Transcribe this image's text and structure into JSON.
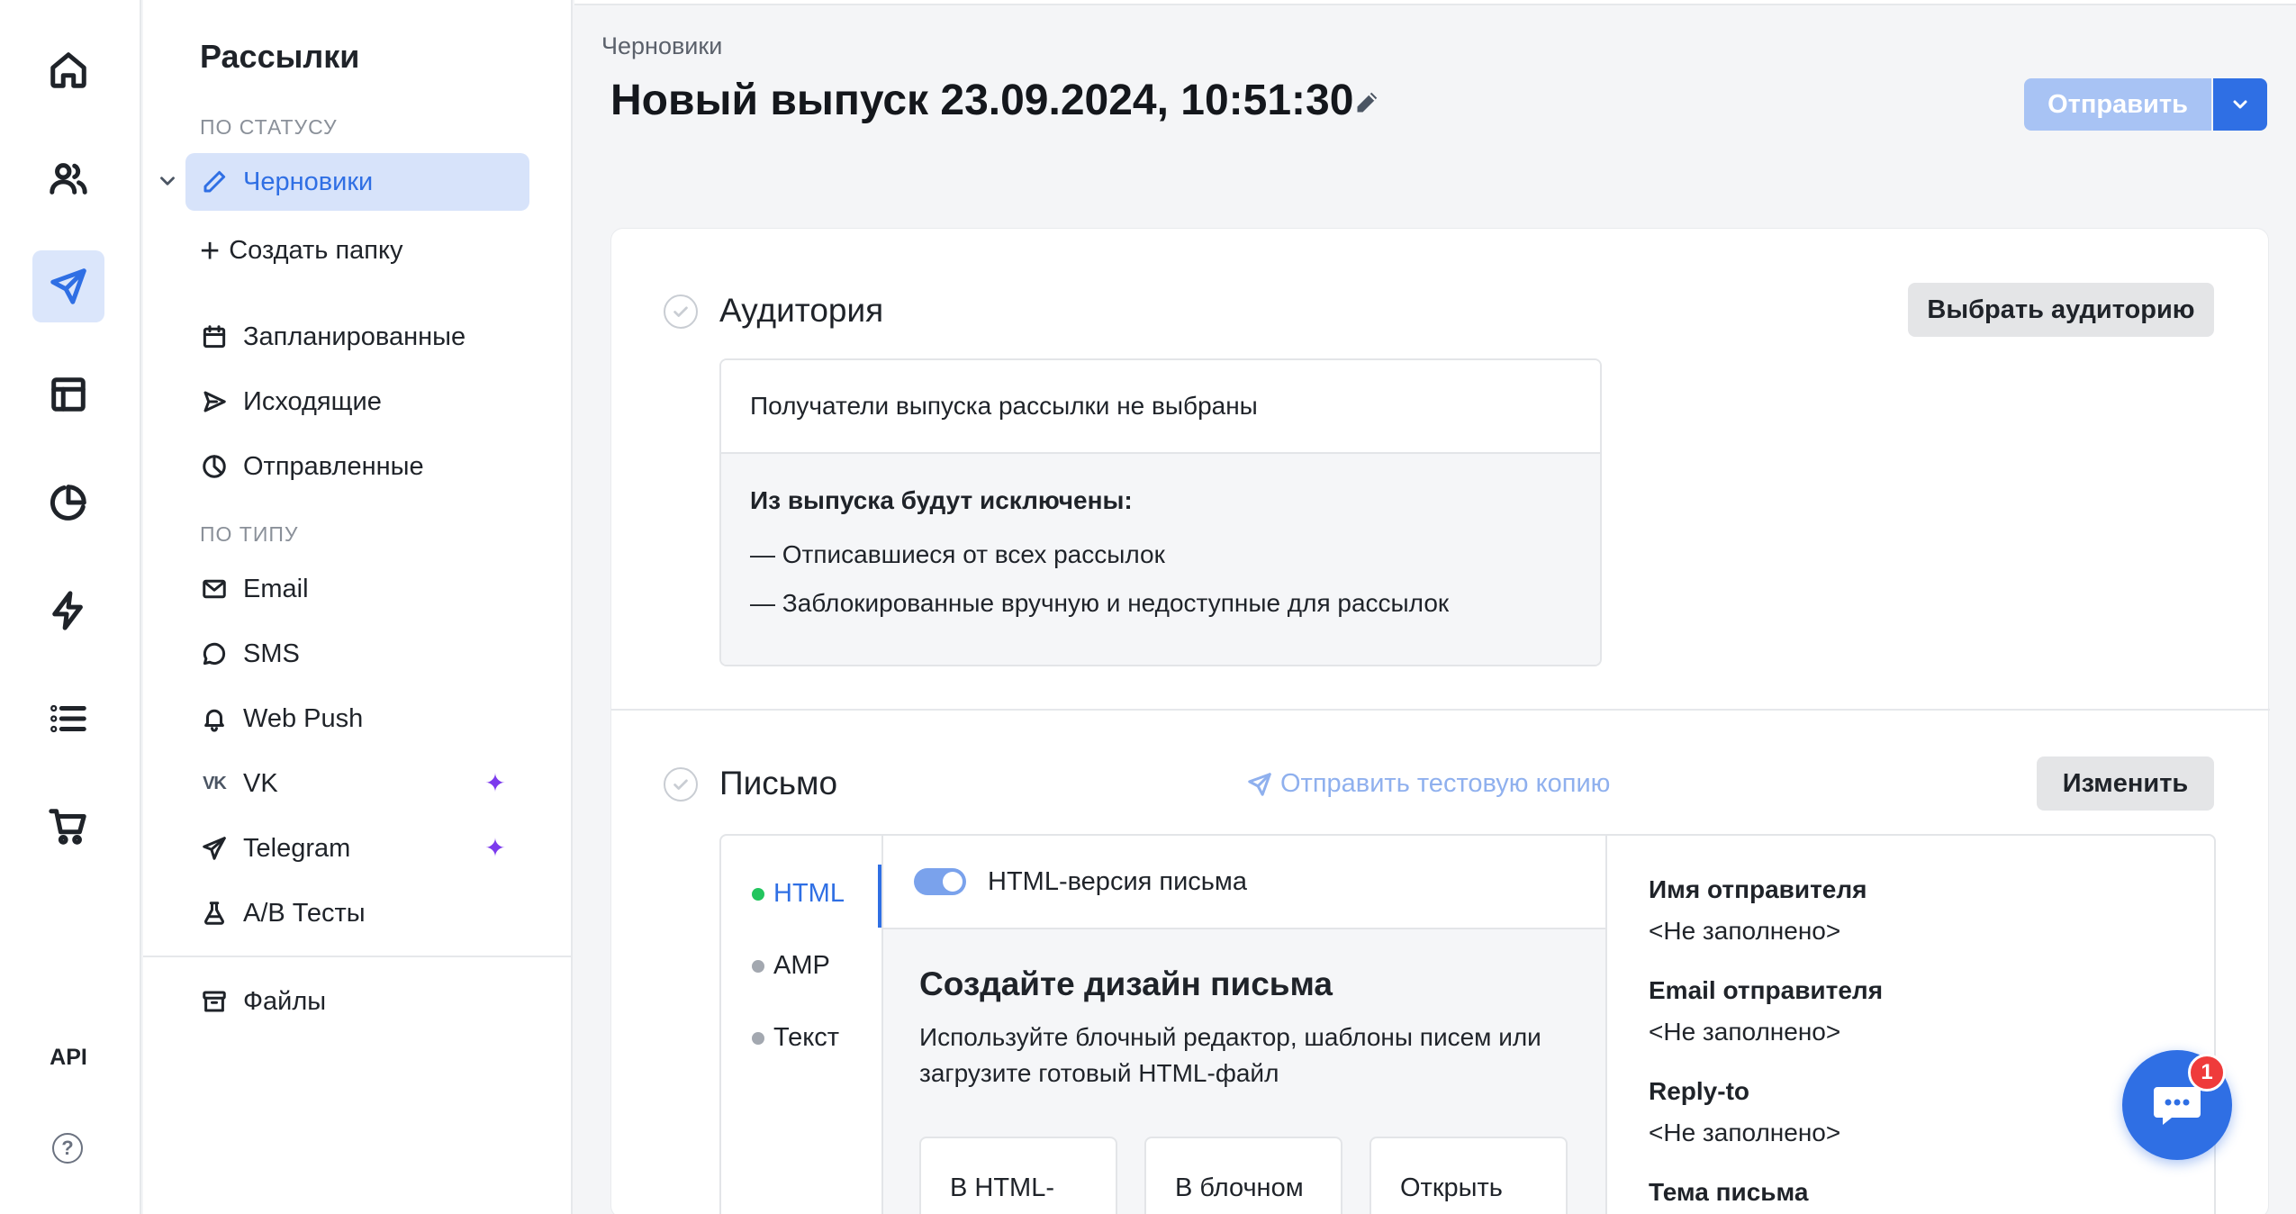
{
  "rail": {
    "api_label": "API",
    "help_label": "?"
  },
  "sidebar": {
    "title": "Рассылки",
    "section_status": "ПО СТАТУСУ",
    "drafts": "Черновики",
    "create_folder": "Создать папку",
    "scheduled": "Запланированные",
    "outgoing": "Исходящие",
    "sent": "Отправленные",
    "section_type": "ПО ТИПУ",
    "email": "Email",
    "sms": "SMS",
    "webpush": "Web Push",
    "vk": "VK",
    "telegram": "Telegram",
    "ab_tests": "A/B Тесты",
    "files": "Файлы"
  },
  "header": {
    "breadcrumb": "Черновики",
    "title": "Новый выпуск 23.09.2024, 10:51:30",
    "send_label": "Отправить"
  },
  "audience": {
    "title": "Аудитория",
    "select_button": "Выбрать аудиторию",
    "no_recipients": "Получатели выпуска рассылки не выбраны",
    "excluded_heading": "Из выпуска будут исключены:",
    "excluded_1": "— Отписавшиеся от всех рассылок",
    "excluded_2": "— Заблокированные вручную и недоступные для рассылок"
  },
  "letter": {
    "title": "Письмо",
    "test_copy": "Отправить тестовую копию",
    "change_button": "Изменить",
    "formats": [
      "HTML",
      "AMP",
      "Текст"
    ],
    "html_version": "HTML-версия письма",
    "design_title": "Создайте дизайн письма",
    "design_desc": "Используйте блочный редактор, шаблоны писем или загрузите готовый HTML-файл",
    "btn_html": "В HTML-редакторе",
    "btn_block": "В блочном редакторе",
    "btn_open": "Открыть галерею",
    "sender_name_label": "Имя отправителя",
    "sender_name_value": "<Не заполнено>",
    "sender_email_label": "Email отправителя",
    "sender_email_value": "<Не заполнено>",
    "reply_to_label": "Reply-to",
    "reply_to_value": "<Не заполнено>",
    "subject_label": "Тема письма"
  },
  "chat": {
    "badge": "1"
  },
  "colors": {
    "accent": "#2f6fe4",
    "send_disabled": "#a8c3f4",
    "active_bg": "#d7e3fa",
    "ai_star": "#7c3aed",
    "badge": "#ef3b3b"
  }
}
